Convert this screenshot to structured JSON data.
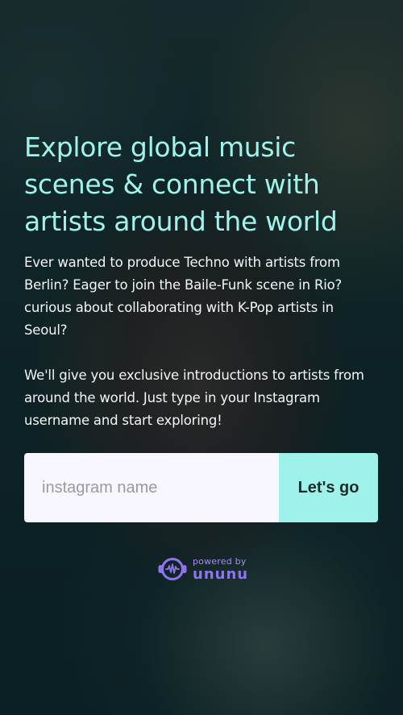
{
  "hero": {
    "headline": "Explore global music scenes & connect with artists around the world",
    "paragraph1": "Ever wanted to produce Techno with artists from Berlin? Eager to join the Baile-Funk scene in Rio? curious about collaborating with K-Pop artists in Seoul?",
    "paragraph2": "We'll give you exclusive introductions to artists from around the world. Just type in your Instagram username and start exploring!"
  },
  "signup": {
    "input_placeholder": "instagram name",
    "input_value": "",
    "submit_label": "Let's go"
  },
  "footer": {
    "powered_by": "powered by",
    "brand": "ununu",
    "brand_icon": "headphones-waveform-icon"
  },
  "colors": {
    "accent": "#9ef4ea",
    "button": "#9ef2ea",
    "input_bg": "#f8f7ff",
    "brand_purple": "#8f74f2"
  }
}
